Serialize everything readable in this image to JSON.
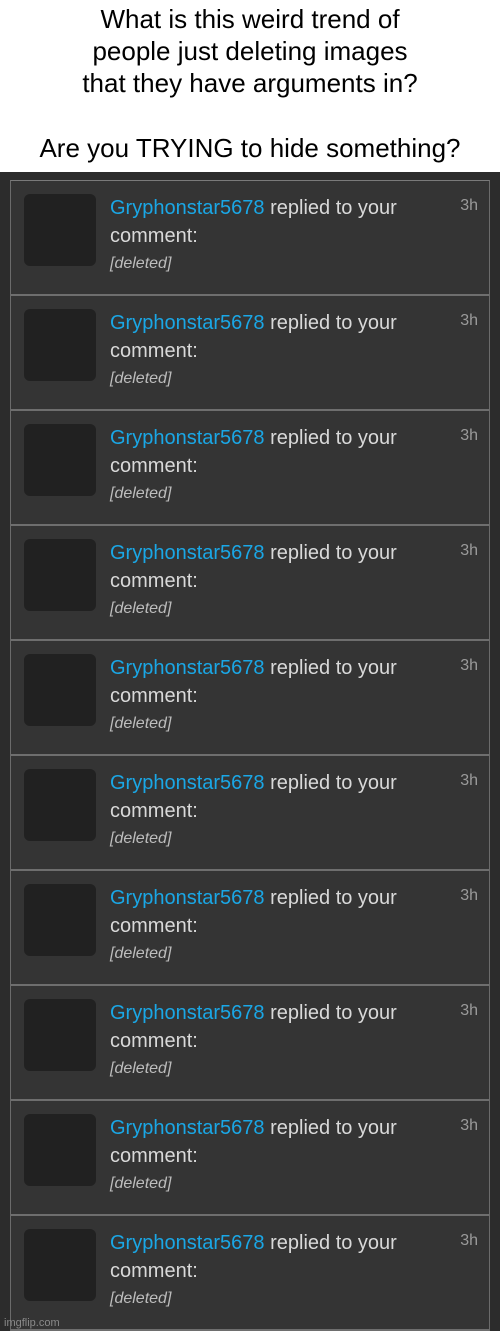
{
  "caption": {
    "line1": "What is this weird trend of\npeople just deleting images\nthat they have arguments in?",
    "line2": "Are you TRYING to hide something?"
  },
  "colors": {
    "panel_background": "#2c2c2c",
    "row_background": "#343434",
    "username": "#1aa7e6",
    "text": "#d9d9d9",
    "avatar": "#212121"
  },
  "notifications": [
    {
      "user": "Gryphonstar5678",
      "action": " replied to your comment:",
      "body": "[deleted]",
      "time": "3h"
    },
    {
      "user": "Gryphonstar5678",
      "action": " replied to your comment:",
      "body": "[deleted]",
      "time": "3h"
    },
    {
      "user": "Gryphonstar5678",
      "action": " replied to your comment:",
      "body": "[deleted]",
      "time": "3h"
    },
    {
      "user": "Gryphonstar5678",
      "action": " replied to your comment:",
      "body": "[deleted]",
      "time": "3h"
    },
    {
      "user": "Gryphonstar5678",
      "action": " replied to your comment:",
      "body": "[deleted]",
      "time": "3h"
    },
    {
      "user": "Gryphonstar5678",
      "action": " replied to your comment:",
      "body": "[deleted]",
      "time": "3h"
    },
    {
      "user": "Gryphonstar5678",
      "action": " replied to your comment:",
      "body": "[deleted]",
      "time": "3h"
    },
    {
      "user": "Gryphonstar5678",
      "action": " replied to your comment:",
      "body": "[deleted]",
      "time": "3h"
    },
    {
      "user": "Gryphonstar5678",
      "action": " replied to your comment:",
      "body": "[deleted]",
      "time": "3h"
    },
    {
      "user": "Gryphonstar5678",
      "action": " replied to your comment:",
      "body": "[deleted]",
      "time": "3h"
    }
  ],
  "watermark": "imgflip.com"
}
